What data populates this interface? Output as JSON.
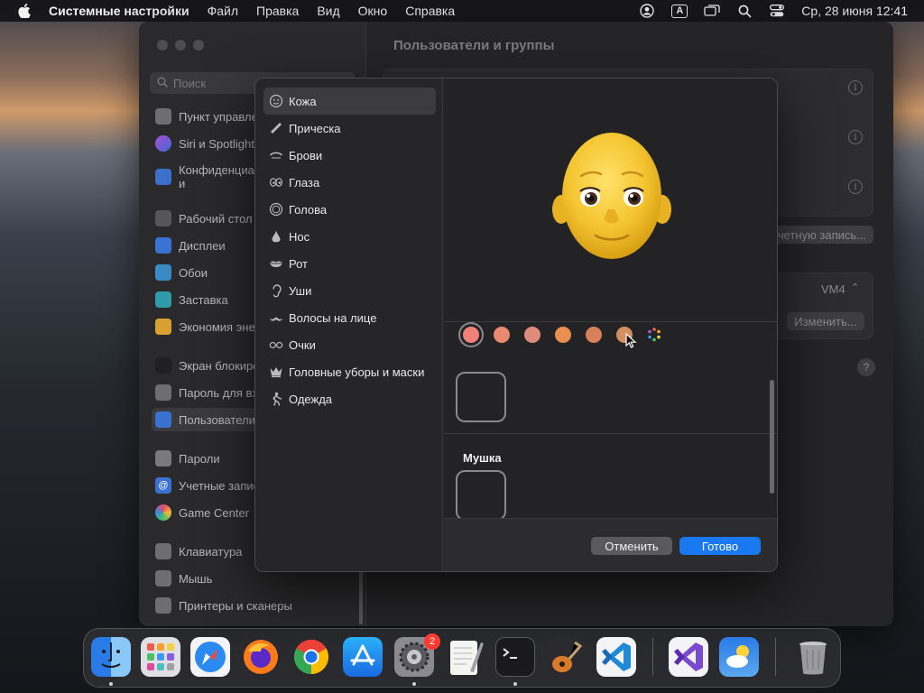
{
  "menubar": {
    "app_name": "Системные настройки",
    "items": [
      "Файл",
      "Правка",
      "Вид",
      "Окно",
      "Справка"
    ],
    "input_indicator": "A",
    "clock": "Ср, 28 июня  12:41"
  },
  "settings": {
    "search_placeholder": "Поиск",
    "title": "Пользователи и группы",
    "sidebar_items": [
      "Пункт управления",
      "Siri и Spotlight",
      "Конфиденциальность и безопасность",
      "Рабочий стол и Dock",
      "Дисплеи",
      "Обои",
      "Заставка",
      "Экономия энергии",
      "Экран блокировки",
      "Пароль для входа",
      "Пользователи и группы",
      "Пароли",
      "Учетные записи интернета",
      "Game Center",
      "Клавиатура",
      "Мышь",
      "Принтеры и сканеры"
    ],
    "add_account_label": "Добавить учетную запись...",
    "server_value": "VM4",
    "edit_label": "Изменить..."
  },
  "dialog": {
    "categories": [
      "Кожа",
      "Прическа",
      "Брови",
      "Глаза",
      "Голова",
      "Нос",
      "Рот",
      "Уши",
      "Волосы на лице",
      "Очки",
      "Головные уборы и маски",
      "Одежда"
    ],
    "selected_category": "Кожа",
    "section_title": "Мушка",
    "cancel_label": "Отменить",
    "done_label": "Готово",
    "skin_swatches": [
      "#f08078",
      "#e98a70",
      "#de8a7c",
      "#e99050",
      "#d8805a",
      "#d49060"
    ]
  },
  "dock": {
    "apps": [
      "Finder",
      "Launchpad",
      "Safari",
      "Firefox",
      "Chrome",
      "App Store",
      "Системные настройки",
      "TextEdit",
      "Терминал",
      "GarageBand",
      "Visual Studio Code",
      "Visual Studio",
      "Погода",
      "Корзина"
    ],
    "settings_badge": "2"
  },
  "colors": {
    "accent": "#1a78f0",
    "badge": "#ff3b30"
  }
}
